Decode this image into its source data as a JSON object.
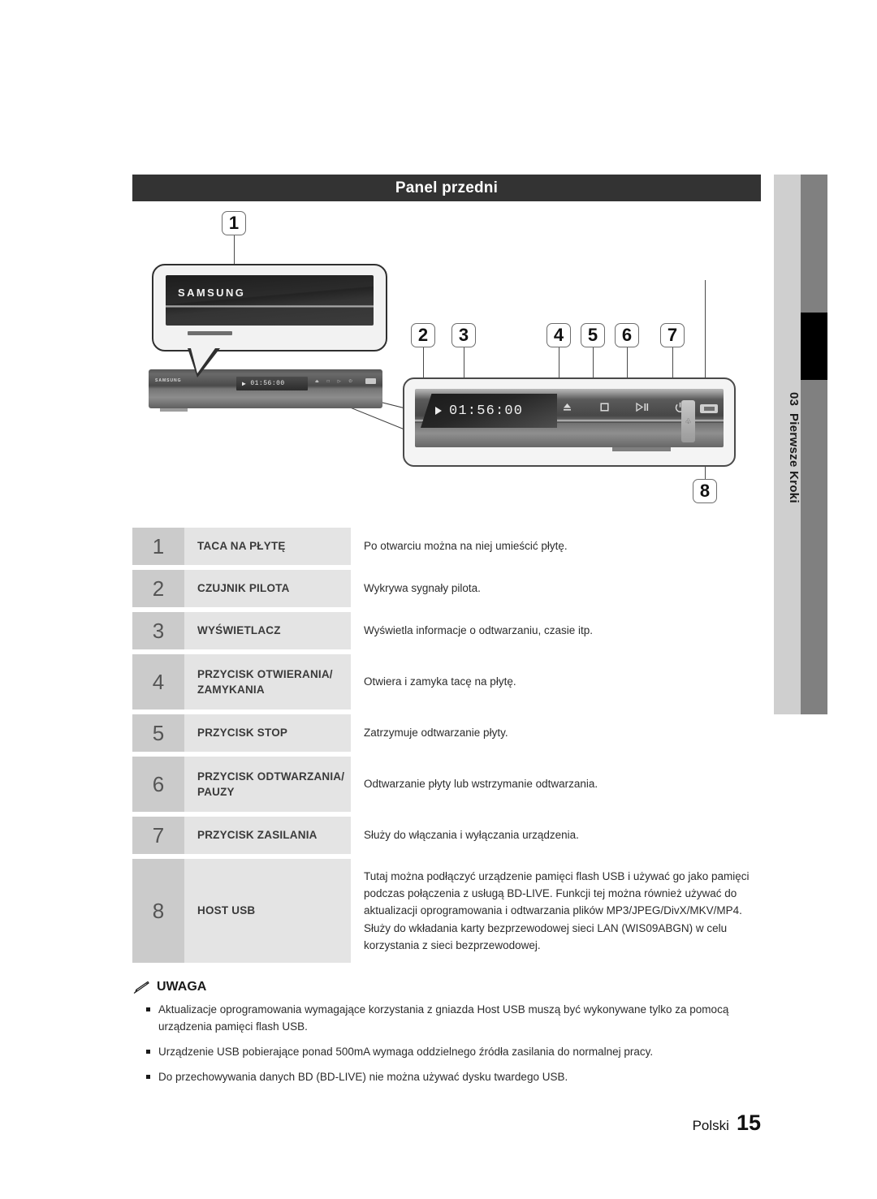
{
  "section": {
    "title": "Panel przedni"
  },
  "chapter_tab": {
    "number": "03",
    "label": "Pierwsze Kroki"
  },
  "illustration": {
    "brand_logo": "SAMSUNG",
    "display_time": "01:56:00",
    "play_indicator": "▶",
    "callouts": [
      "1",
      "2",
      "3",
      "4",
      "5",
      "6",
      "7",
      "8"
    ],
    "buttons": [
      {
        "name": "eject-button",
        "glyph": "⏏"
      },
      {
        "name": "stop-button",
        "glyph": "□"
      },
      {
        "name": "play-pause-button",
        "glyph": "▷Ⅱ"
      },
      {
        "name": "power-button",
        "glyph": "⏻"
      }
    ],
    "usb_port_label": "USB"
  },
  "spec_table": {
    "rows": [
      {
        "num": "1",
        "label": "TACA NA PŁYTĘ",
        "desc": "Po otwarciu można na niej umieścić płytę."
      },
      {
        "num": "2",
        "label": "CZUJNIK PILOTA",
        "desc": "Wykrywa sygnały pilota."
      },
      {
        "num": "3",
        "label": "WYŚWIETLACZ",
        "desc": "Wyświetla informacje o odtwarzaniu, czasie itp."
      },
      {
        "num": "4",
        "label": "PRZYCISK OTWIERANIA/ ZAMYKANIA",
        "desc": "Otwiera i zamyka tacę na płytę."
      },
      {
        "num": "5",
        "label": "PRZYCISK STOP",
        "desc": "Zatrzymuje odtwarzanie płyty."
      },
      {
        "num": "6",
        "label": "PRZYCISK ODTWARZANIA/ PAUZY",
        "desc": "Odtwarzanie płyty lub wstrzymanie odtwarzania."
      },
      {
        "num": "7",
        "label": "PRZYCISK ZASILANIA",
        "desc": "Służy do włączania i wyłączania urządzenia."
      },
      {
        "num": "8",
        "label": "HOST USB",
        "desc": "Tutaj można podłączyć urządzenie pamięci flash USB i używać go jako pamięci podczas połączenia z usługą BD-LIVE. Funkcji tej można również używać do aktualizacji oprogramowania i odtwarzania plików MP3/JPEG/DivX/MKV/MP4. Służy do wkładania karty bezprzewodowej sieci LAN (WIS09ABGN) w celu korzystania z sieci bezprzewodowej."
      }
    ]
  },
  "note": {
    "heading": "UWAGA",
    "items": [
      "Aktualizacje oprogramowania wymagające korzystania z gniazda Host USB muszą być wykonywane tylko za pomocą urządzenia pamięci flash USB.",
      "Urządzenie USB pobierające ponad 500mA wymaga oddzielnego źródła zasilania do normalnej pracy.",
      "Do przechowywania danych BD (BD-LIVE) nie można używać dysku twardego USB."
    ]
  },
  "footer": {
    "language": "Polski",
    "page_number": "15"
  },
  "colors": {
    "header_bar": "#333333",
    "tab_light": "#cfcfcf",
    "tab_dark": "#808080",
    "tab_current": "#000000",
    "num_cell": "#cbcbcb",
    "label_cell": "#e4e4e4"
  }
}
